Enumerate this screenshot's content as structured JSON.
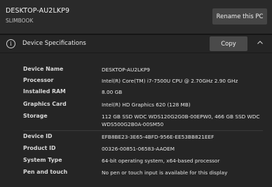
{
  "header": {
    "device_name": "DESKTOP-AU2LKP9",
    "model": "SLIMBOOK",
    "rename_label": "Rename this PC"
  },
  "specs_section": {
    "title": "Device Specifications",
    "copy_label": "Copy",
    "info_icon": "info-icon",
    "collapse_icon": "chevron-up-icon",
    "rows": [
      {
        "label": "Device Name",
        "value": "DESKTOP-AU2LKP9"
      },
      {
        "label": "Processor",
        "value": "Intel(R) Core(TM) i7-7500U CPU @ 2.70GHz   2.90 GHz"
      },
      {
        "label": "Installed RAM",
        "value": "8.00 GB"
      },
      {
        "label": "Graphics Card",
        "value": "Intel(R) HD Graphics 620 (128 MB)"
      },
      {
        "label": "Storage",
        "value": "112 GB SSD WDC WDS120G2G0B-00EPW0, 466 GB SSD WDC WDS500G2B0A-00SM50"
      },
      {
        "label": "Device ID",
        "value": "EFB8BE23-3E65-4BFD-956E-EE53BB821EEF"
      },
      {
        "label": "Product ID",
        "value": "00326-00851-06583-AAOEM"
      },
      {
        "label": "System Type",
        "value": "64-bit operating system, x64-based processor"
      },
      {
        "label": "Pen and touch",
        "value": "No pen or touch input is available for this display"
      }
    ]
  },
  "colors": {
    "background": "#1c1c1c",
    "header_bg": "#2a2a2a",
    "section_bg": "#252525",
    "button_bg": "#454545"
  }
}
